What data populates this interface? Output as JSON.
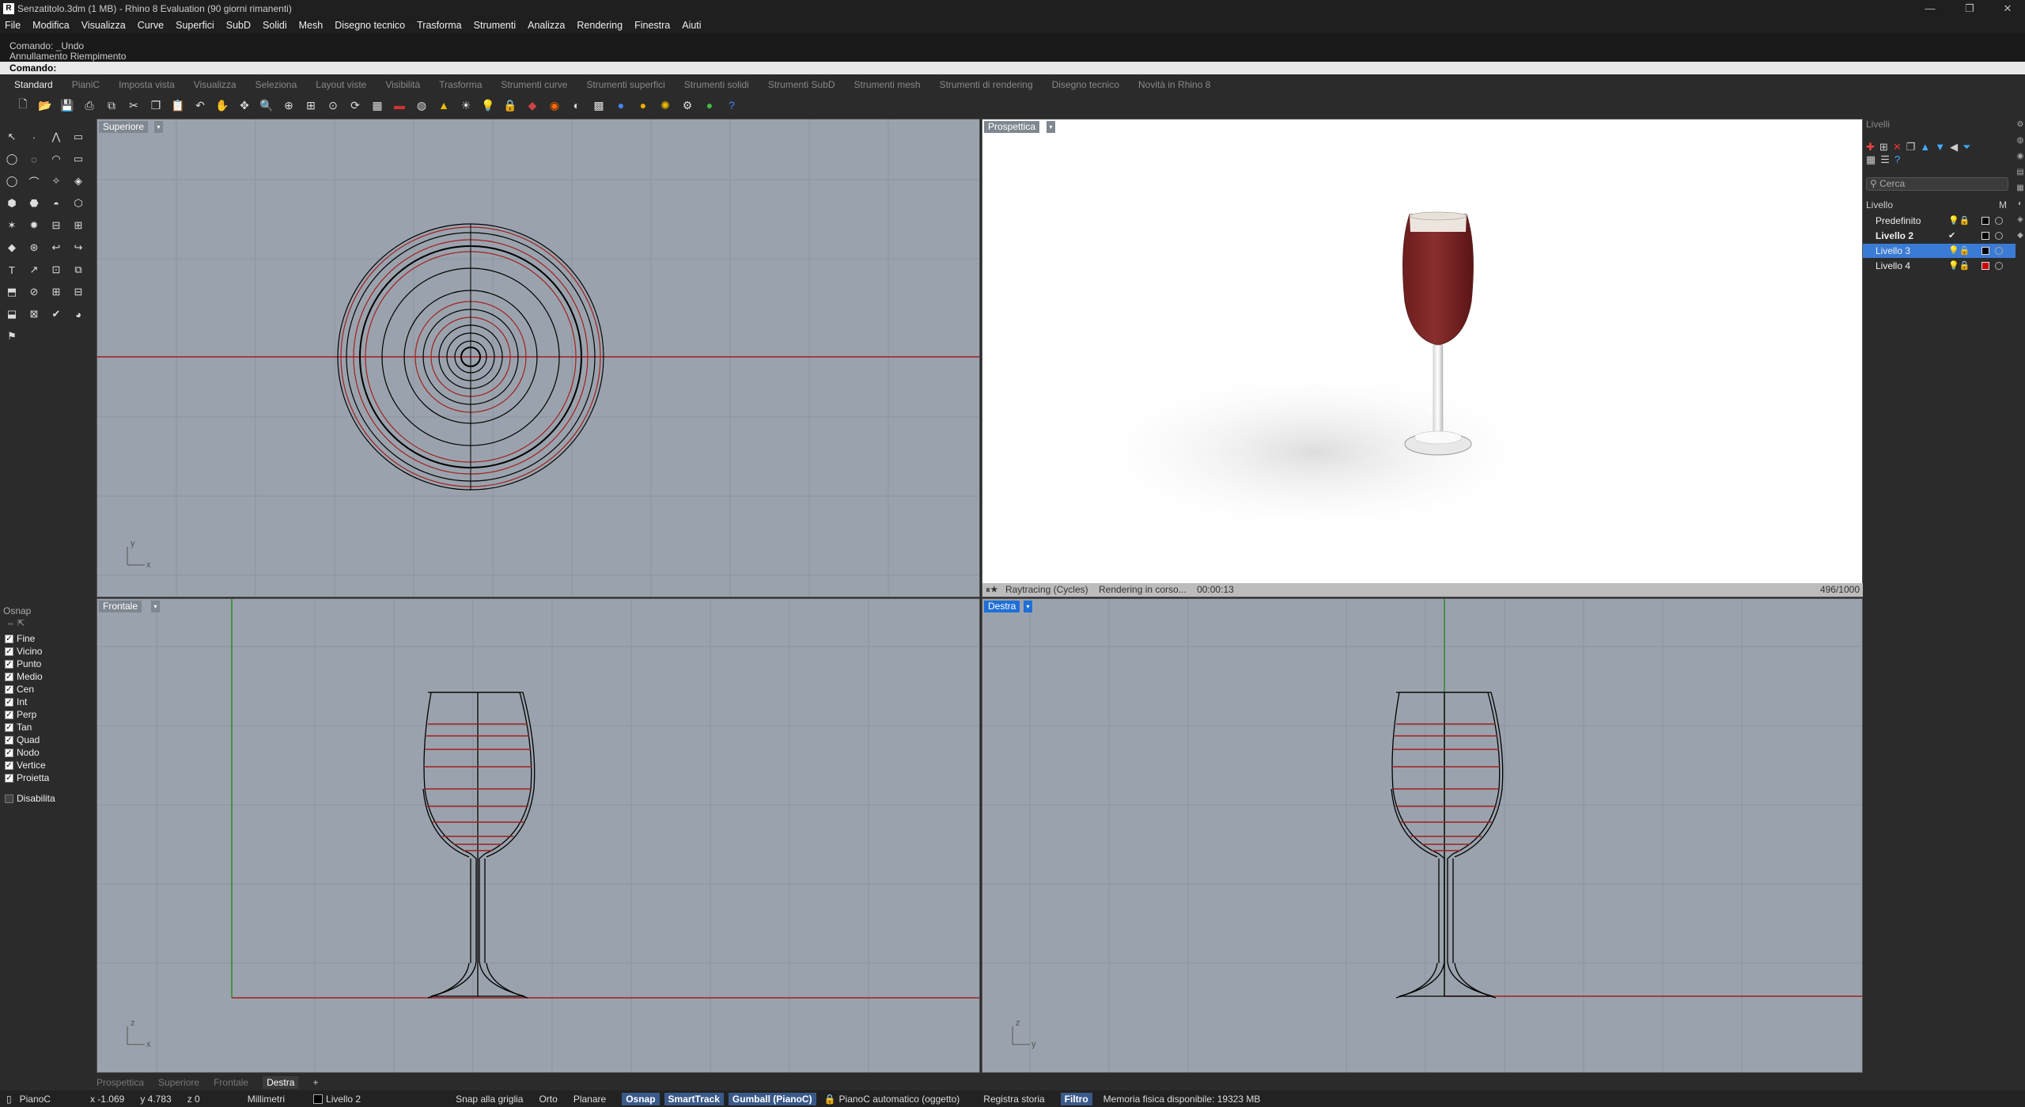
{
  "title": "Senzatitolo.3dm (1 MB) - Rhino 8 Evaluation (90 giorni rimanenti)",
  "menu": [
    "File",
    "Modifica",
    "Visualizza",
    "Curve",
    "Superfici",
    "SubD",
    "Solidi",
    "Mesh",
    "Disegno tecnico",
    "Trasforma",
    "Strumenti",
    "Analizza",
    "Rendering",
    "Finestra",
    "Aiuti"
  ],
  "command_history": [
    "Comando: _Undo",
    "Annullamento Riempimento"
  ],
  "command_prompt": "Comando:",
  "toolbar_tabs": [
    "Standard",
    "PianiC",
    "Imposta vista",
    "Visualizza",
    "Seleziona",
    "Layout viste",
    "Visibilità",
    "Trasforma",
    "Strumenti curve",
    "Strumenti superfici",
    "Strumenti solidi",
    "Strumenti SubD",
    "Strumenti mesh",
    "Strumenti di rendering",
    "Disegno tecnico",
    "Novità in Rhino 8"
  ],
  "viewports": {
    "top": {
      "label": "Superiore"
    },
    "perspective": {
      "label": "Prospettica"
    },
    "front": {
      "label": "Frontale"
    },
    "right": {
      "label": "Destra"
    }
  },
  "render_status": {
    "engine": "Raytracing (Cycles)",
    "state": "Rendering in corso...",
    "time": "00:00:13",
    "progress": "496/1000"
  },
  "osnap": {
    "title": "Osnap",
    "items": [
      "Fine",
      "Vicino",
      "Punto",
      "Medio",
      "Cen",
      "Int",
      "Perp",
      "Tan",
      "Quad",
      "Nodo",
      "Vertice",
      "Proietta"
    ],
    "disable": "Disabilita"
  },
  "layers": {
    "title": "Livelli",
    "search_placeholder": "Cerca",
    "col_name": "Livello",
    "col_m": "M",
    "items": [
      {
        "name": "Predefinito",
        "color": "#000000",
        "current": false,
        "selected": false
      },
      {
        "name": "Livello 2",
        "color": "#000000",
        "current": true,
        "selected": false
      },
      {
        "name": "Livello 3",
        "color": "#000000",
        "current": false,
        "selected": true
      },
      {
        "name": "Livello 4",
        "color": "#d00000",
        "current": false,
        "selected": false
      }
    ]
  },
  "bottom_tabs": [
    "Prospettica",
    "Superiore",
    "Frontale",
    "Destra"
  ],
  "status": {
    "cplane": "PianoC",
    "x": "x -1.069",
    "y": "y 4.783",
    "z": "z 0",
    "units": "Millimetri",
    "layer": "Livello 2",
    "snap": "Snap alla griglia",
    "orto": "Orto",
    "planare": "Planare",
    "osnap": "Osnap",
    "smarttrack": "SmartTrack",
    "gumball": "Gumball (PianoC)",
    "auto_cplane": "PianoC automatico (oggetto)",
    "history": "Registra storia",
    "filter": "Filtro",
    "memory": "Memoria fisica disponibile: 19323 MB"
  },
  "colors": {
    "accent": "#3a7bd5",
    "viewport_bg": "#9aa3ad",
    "curve_red": "#b02020",
    "curve_black": "#000000"
  }
}
